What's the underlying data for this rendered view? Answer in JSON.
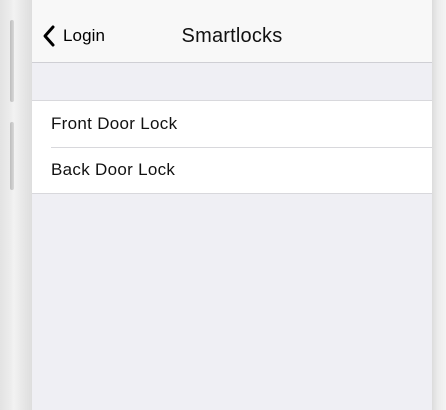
{
  "navbar": {
    "back_label": "Login",
    "title": "Smartlocks"
  },
  "locks": [
    {
      "label": "Front Door Lock"
    },
    {
      "label": "Back Door Lock"
    }
  ],
  "icons": {
    "back": "chevron-left-icon"
  },
  "colors": {
    "background": "#efeff4",
    "navbar": "#f8f8f8",
    "row": "#ffffff",
    "separator": "#d8d8dc"
  }
}
